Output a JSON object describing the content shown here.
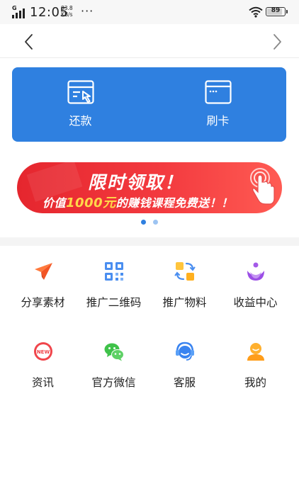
{
  "status_bar": {
    "network": "G",
    "time": "12:05",
    "speed_value": "83.8",
    "speed_unit": "KB/s",
    "more": "···",
    "battery": "89",
    "battery_level": 0.89
  },
  "nav": {
    "back_icon": "chevron-left-icon",
    "forward_icon": "chevron-right-icon"
  },
  "card": {
    "accent": "#2f80e0",
    "repay_label": "还款",
    "repay_icon": "repay-window-icon",
    "swipe_label": "刷卡",
    "swipe_icon": "card-window-icon"
  },
  "banner": {
    "title": "限时领取！",
    "sub_prefix": "价值",
    "sub_highlight": "1000元",
    "sub_suffix": "的赚钱课程免费送！！",
    "accent": "#e5262e",
    "highlight_color": "#ffd84a"
  },
  "pager": {
    "total": 2,
    "active": 1
  },
  "grid": [
    {
      "label": "分享素材",
      "icon": "paper-plane-icon"
    },
    {
      "label": "推广二维码",
      "icon": "qr-code-icon"
    },
    {
      "label": "推广物料",
      "icon": "materials-icon"
    },
    {
      "label": "收益中心",
      "icon": "income-icon"
    },
    {
      "label": "资讯",
      "icon": "news-icon"
    },
    {
      "label": "官方微信",
      "icon": "wechat-icon"
    },
    {
      "label": "客服",
      "icon": "customer-service-icon"
    },
    {
      "label": "我的",
      "icon": "profile-icon"
    }
  ]
}
